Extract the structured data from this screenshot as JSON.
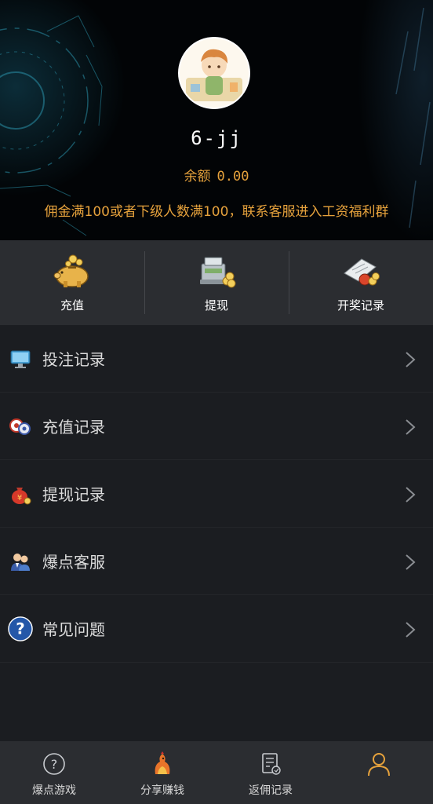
{
  "profile": {
    "username": "6-jj",
    "balance_label": "余额",
    "balance_value": "0.00",
    "notice": "佣金满100或者下级人数满100，联系客服进入工资福利群"
  },
  "actions": [
    {
      "label": "充值",
      "icon": "piggy-bank-icon"
    },
    {
      "label": "提现",
      "icon": "cash-register-icon"
    },
    {
      "label": "开奖记录",
      "icon": "lottery-record-icon"
    }
  ],
  "menu": [
    {
      "label": "投注记录",
      "icon": "monitor-icon"
    },
    {
      "label": "充值记录",
      "icon": "chips-icon"
    },
    {
      "label": "提现记录",
      "icon": "money-bag-icon"
    },
    {
      "label": "爆点客服",
      "icon": "customer-service-icon"
    },
    {
      "label": "常见问题",
      "icon": "question-icon"
    }
  ],
  "tabbar": [
    {
      "label": "爆点游戏",
      "icon": "question-circle-icon"
    },
    {
      "label": "分享赚钱",
      "icon": "rooster-icon"
    },
    {
      "label": "返佣记录",
      "icon": "document-icon"
    },
    {
      "label": "",
      "icon": "user-icon",
      "active": true
    }
  ],
  "colors": {
    "accent": "#e6a23c",
    "page_bg": "#1b1d21",
    "panel_bg": "#2b2d31",
    "header_bg": "#020406"
  }
}
